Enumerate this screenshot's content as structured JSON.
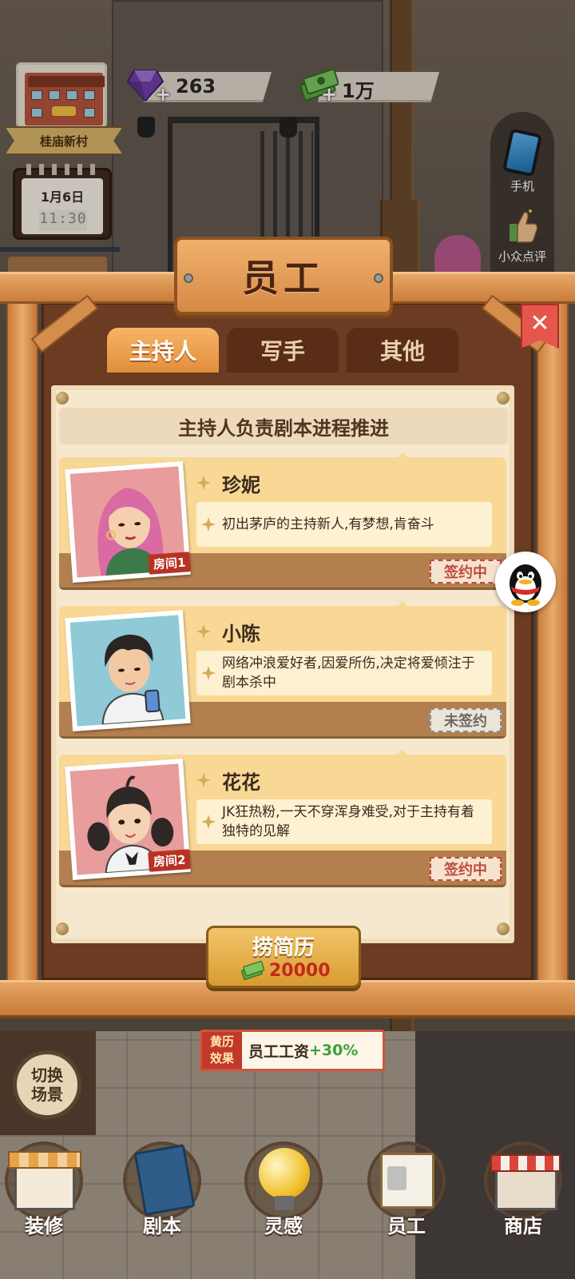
{
  "hud": {
    "location": "桂庙新村",
    "date": "1月6日",
    "time": "11:30",
    "gems": "263",
    "cash": "1万",
    "gem_plus": "+",
    "cash_plus": "+"
  },
  "side": {
    "phone_label": "手机",
    "review_label": "小众点评"
  },
  "modal": {
    "title": "员工",
    "close": "✕",
    "tabs": [
      {
        "label": "主持人",
        "active": true
      },
      {
        "label": "写手",
        "active": false
      },
      {
        "label": "其他",
        "active": false
      }
    ],
    "description": "主持人负责剧本进程推进",
    "staff": [
      {
        "name": "珍妮",
        "desc": "初出茅庐的主持新人,有梦想,肯奋斗",
        "room": "房间1",
        "status": "签约中"
      },
      {
        "name": "小陈",
        "desc": "网络冲浪爱好者,因爱所伤,决定将爱倾注于剧本杀中",
        "room": "",
        "status": "未签约"
      },
      {
        "name": "花花",
        "desc": "JK狂热粉,一天不穿浑身难受,对于主持有着独特的见解",
        "room": "房间2",
        "status": "签约中"
      }
    ],
    "recruit_label": "捞简历",
    "recruit_cost": "20000"
  },
  "almanac": {
    "badge_line1": "黄历",
    "badge_line2": "效果",
    "text": "员工工资",
    "bonus": "+30%"
  },
  "switch_scene": {
    "line1": "切换",
    "line2": "场景"
  },
  "nav": [
    {
      "label": "装修",
      "icon": "shop-house-icon"
    },
    {
      "label": "剧本",
      "icon": "script-book-icon"
    },
    {
      "label": "灵感",
      "icon": "lightbulb-icon"
    },
    {
      "label": "员工",
      "icon": "staff-card-icon"
    },
    {
      "label": "商店",
      "icon": "store-icon"
    }
  ],
  "colors": {
    "active_tab": "#e18e3d",
    "signed_stamp": "#c24a3c",
    "unsigned_stamp": "#6c6863",
    "bonus_green": "#3aa03a",
    "cost_red": "#c2281e"
  }
}
